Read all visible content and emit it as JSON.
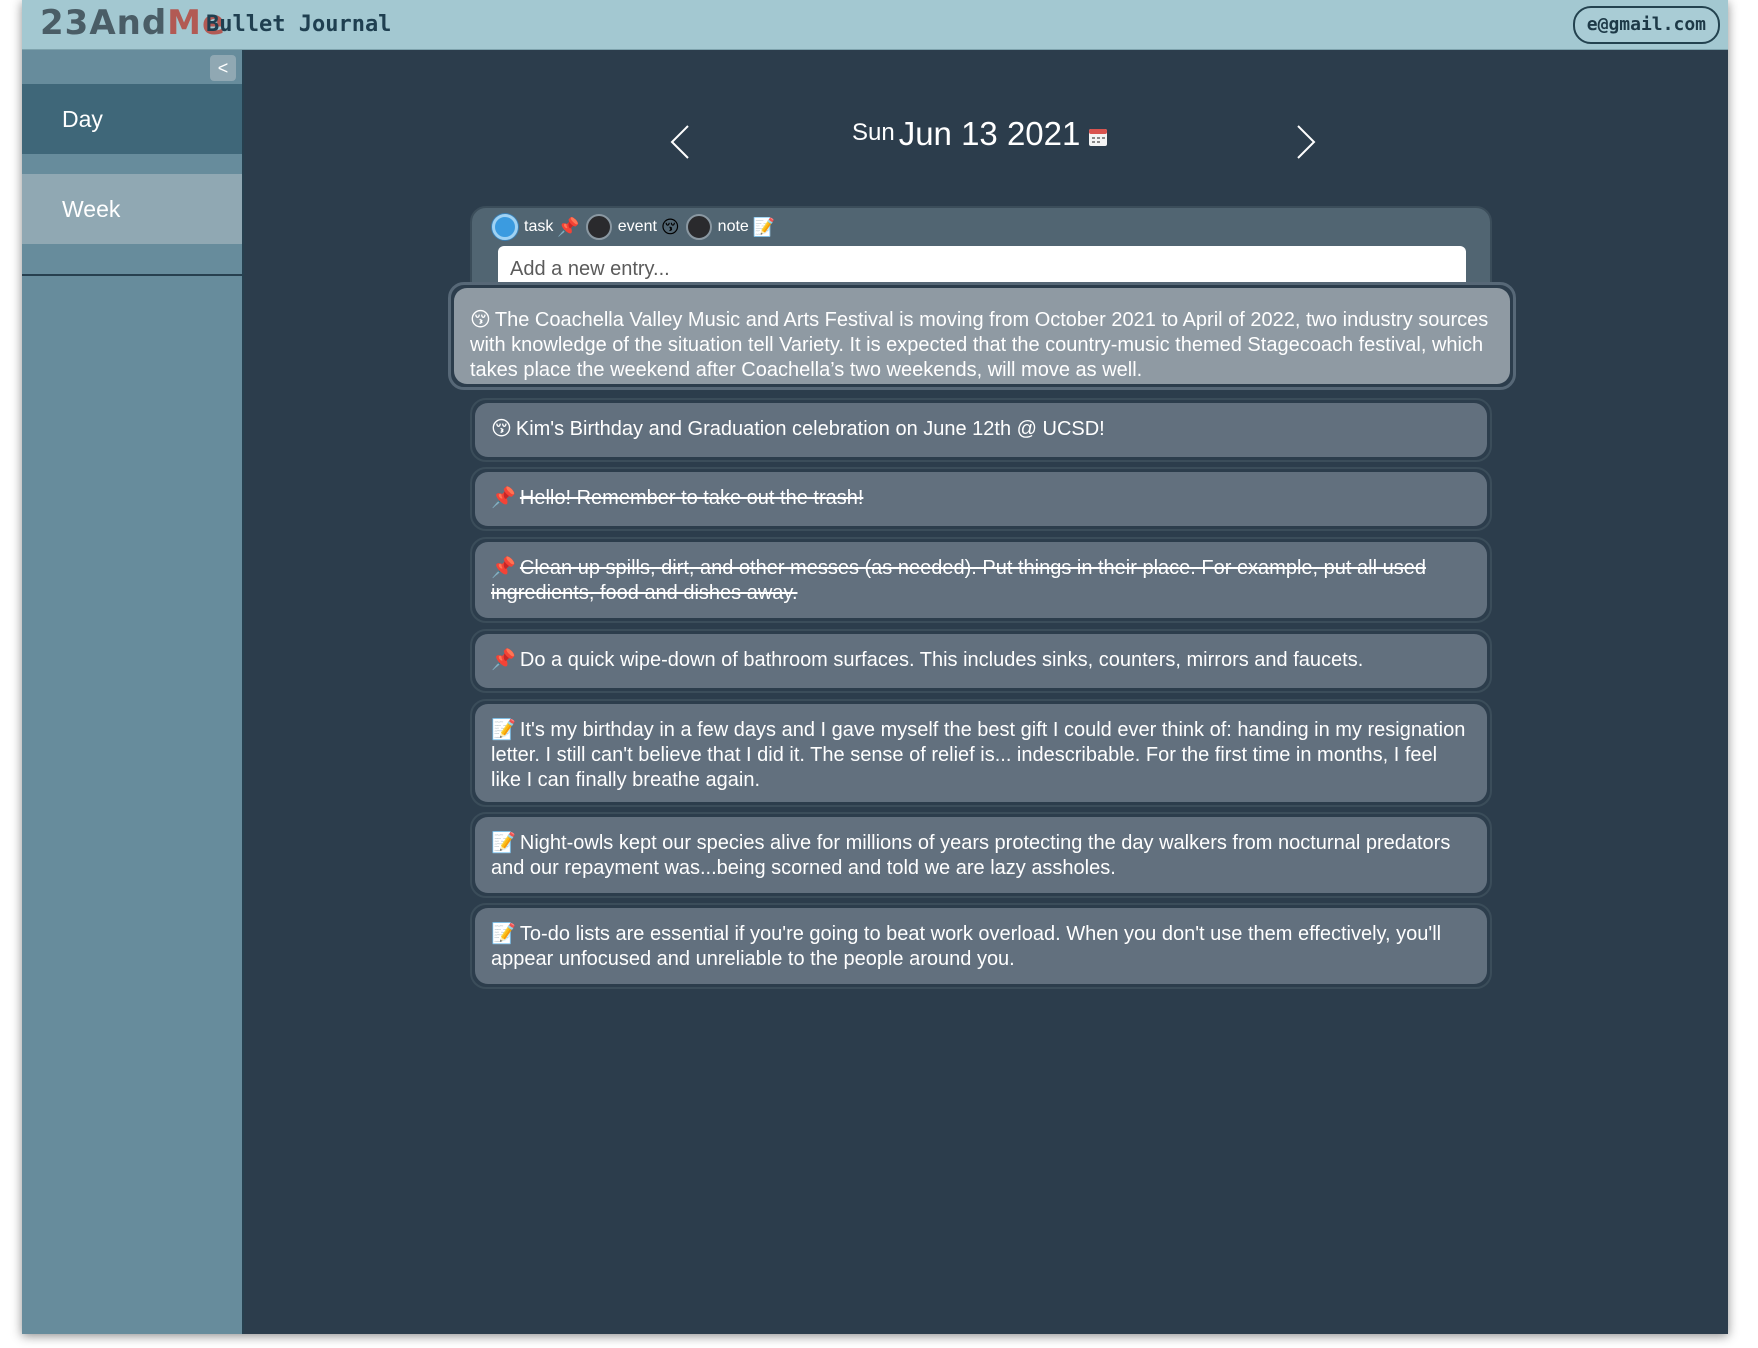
{
  "header": {
    "logo_main": "23And",
    "logo_accent": "Me",
    "logo_sub": "Bullet Journal",
    "account": "e@gmail.com"
  },
  "sidebar": {
    "collapse_label": "<",
    "items": [
      {
        "label": "Day",
        "active": true
      },
      {
        "label": "Week",
        "active": false
      }
    ]
  },
  "date_nav": {
    "day_of_week": "Sun",
    "date": "Jun 13 2021"
  },
  "entry_form": {
    "types": [
      {
        "label": "task",
        "emoji": "📌",
        "checked": true
      },
      {
        "label": "event",
        "emoji": "😚",
        "checked": false
      },
      {
        "label": "note",
        "emoji": "📝",
        "checked": false
      }
    ],
    "placeholder": "Add a new entry..."
  },
  "entries": [
    {
      "type": "event",
      "emoji": "😚",
      "done": false,
      "expanded": true,
      "text": "The Coachella Valley Music and Arts Festival is moving from October 2021 to April of 2022, two industry sources with knowledge of the situation tell Variety. It is expected that the country-music themed Stagecoach festival, which takes place the weekend after Coachella’s two weekends, will move as well."
    },
    {
      "type": "event",
      "emoji": "😚",
      "done": false,
      "expanded": false,
      "text": "Kim's Birthday and Graduation celebration on June 12th @ UCSD!"
    },
    {
      "type": "task",
      "emoji": "📌",
      "done": true,
      "expanded": false,
      "text": "Hello! Remember to take out the trash!"
    },
    {
      "type": "task",
      "emoji": "📌",
      "done": true,
      "expanded": false,
      "text": "Clean up spills, dirt, and other messes (as needed). Put things in their place. For example, put all used ingredients, food and dishes away."
    },
    {
      "type": "task",
      "emoji": "📌",
      "done": false,
      "expanded": false,
      "text": "Do a quick wipe-down of bathroom surfaces. This includes sinks, counters, mirrors and faucets."
    },
    {
      "type": "note",
      "emoji": "📝",
      "done": false,
      "expanded": false,
      "text": "It's my birthday in a few days and I gave myself the best gift I could ever think of: handing in my resignation letter. I still can't believe that I did it. The sense of relief is... indescribable. For the first time in months, I feel like I can finally breathe again."
    },
    {
      "type": "note",
      "emoji": "📝",
      "done": false,
      "expanded": false,
      "text": "Night-owls kept our species alive for millions of years protecting the day walkers from nocturnal predators and our repayment was...being scorned and told we are lazy assholes."
    },
    {
      "type": "note",
      "emoji": "📝",
      "done": false,
      "expanded": false,
      "text": "To-do lists are essential if you're going to beat work overload. When you don't use them effectively, you'll appear unfocused and unreliable to the people around you."
    }
  ]
}
